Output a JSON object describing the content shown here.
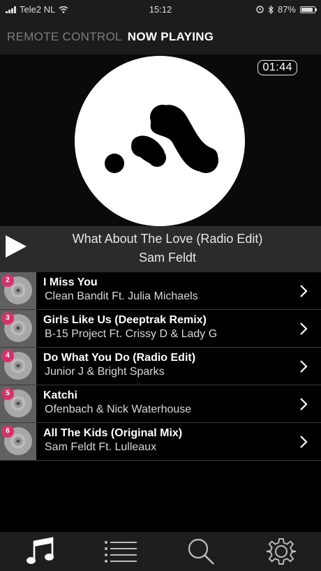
{
  "status_bar": {
    "carrier": "Tele2 NL",
    "time": "15:12",
    "battery": "87%",
    "battery_level": 0.87
  },
  "header": {
    "tab_remote": "REMOTE CONTROL",
    "tab_now_playing": "NOW PLAYING"
  },
  "now_playing": {
    "timer": "01:44",
    "title": "What About The Love (Radio Edit)",
    "artist": "Sam Feldt"
  },
  "queue": [
    {
      "number": "2",
      "title": "I Miss You",
      "artist": "Clean Bandit Ft. Julia Michaels"
    },
    {
      "number": "3",
      "title": "Girls Like Us (Deeptrak Remix)",
      "artist": "B-15 Project Ft. Crissy D & Lady G"
    },
    {
      "number": "4",
      "title": "Do What You Do (Radio Edit)",
      "artist": "Junior J & Bright Sparks"
    },
    {
      "number": "5",
      "title": "Katchi",
      "artist": "Ofenbach & Nick Waterhouse"
    },
    {
      "number": "6",
      "title": "All The Kids (Original Mix)",
      "artist": "Sam Feldt Ft. Lulleaux"
    }
  ],
  "tabs": [
    {
      "icon": "music-note-icon"
    },
    {
      "icon": "list-icon"
    },
    {
      "icon": "search-icon"
    },
    {
      "icon": "gear-icon"
    }
  ],
  "colors": {
    "badge": "#d6336c",
    "background": "#000000",
    "player_bar": "#2b2b2b"
  }
}
